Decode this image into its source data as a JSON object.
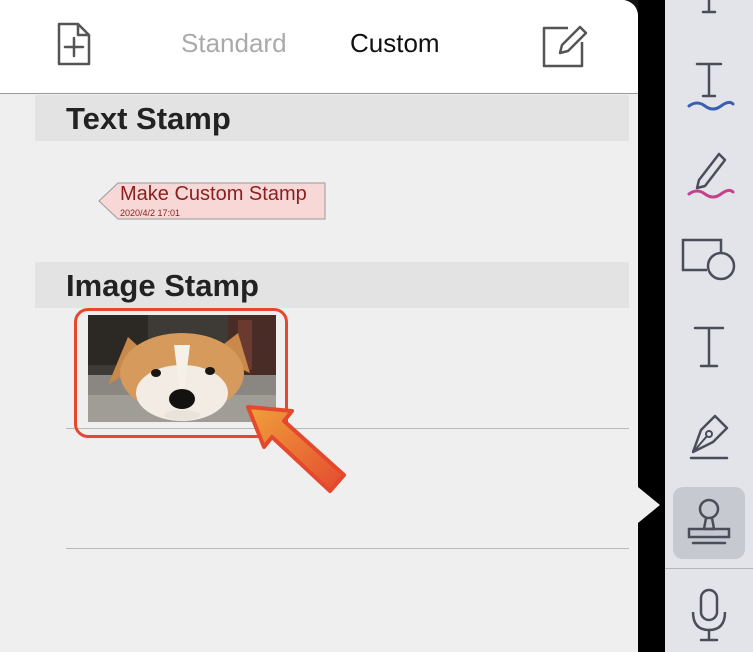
{
  "header": {
    "add_icon": "new-document-icon",
    "tabs": [
      {
        "label": "Standard",
        "selected": false
      },
      {
        "label": "Custom",
        "selected": true
      }
    ],
    "edit_icon": "edit-icon"
  },
  "sections": {
    "text_stamp": {
      "title": "Text Stamp",
      "stamp": {
        "text": "Make Custom Stamp",
        "date": "2020/4/2 17:01",
        "color": "#8a1f1f",
        "fill": "#f8d7d7"
      }
    },
    "image_stamp": {
      "title": "Image Stamp",
      "image": "dog-photo"
    }
  },
  "annotation": {
    "highlight_color": "#e4492e",
    "arrow_color": "#e4492e"
  },
  "toolbar": {
    "tools": [
      {
        "name": "text-icon-partial"
      },
      {
        "name": "text-underline-icon"
      },
      {
        "name": "pencil-highlight-icon"
      },
      {
        "name": "shapes-icon"
      },
      {
        "name": "text-icon"
      },
      {
        "name": "pen-icon"
      },
      {
        "name": "stamp-icon",
        "active": true
      },
      {
        "name": "microphone-icon"
      }
    ]
  }
}
